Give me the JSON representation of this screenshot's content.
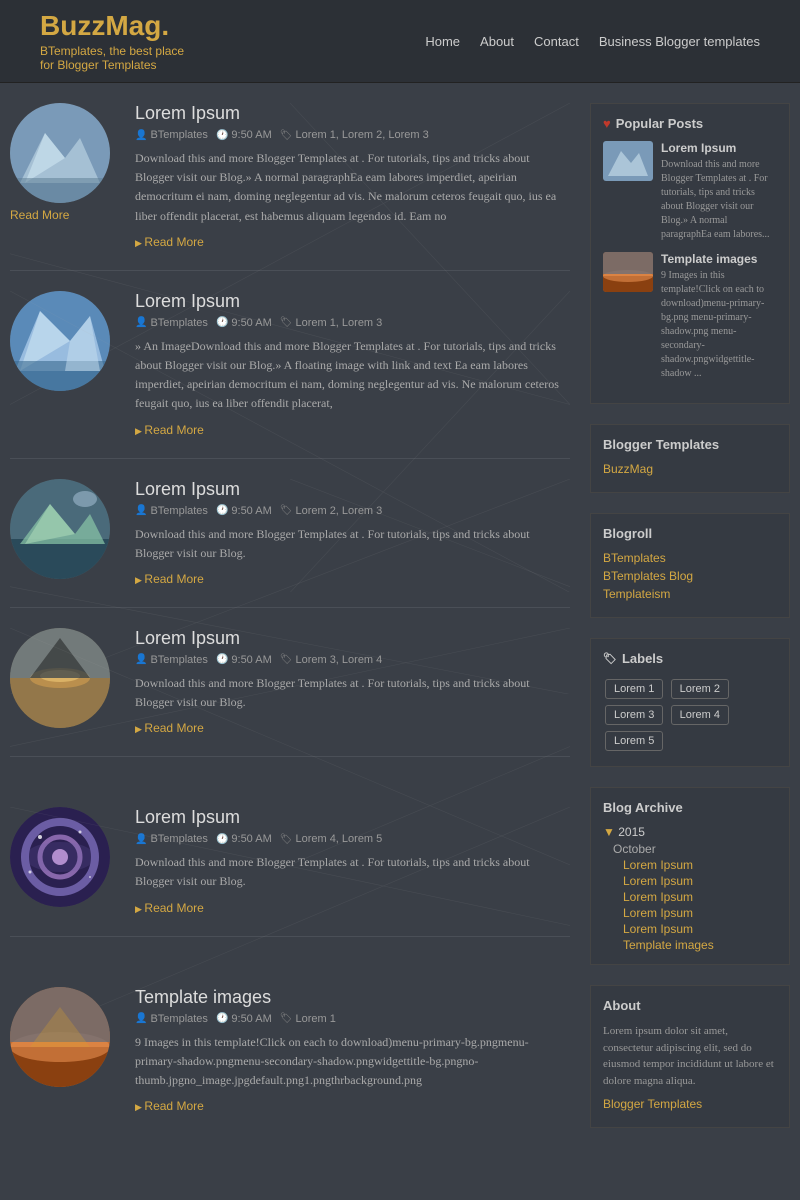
{
  "header": {
    "logo_main": "BuzzMag",
    "logo_dot": ".",
    "logo_sub_line1": "BTemplates, the best place",
    "logo_sub_line2": "for Blogger Templates",
    "nav": [
      {
        "label": "Home",
        "href": "#"
      },
      {
        "label": "About",
        "href": "#"
      },
      {
        "label": "Contact",
        "href": "#"
      },
      {
        "label": "Business Blogger templates",
        "href": "#"
      }
    ]
  },
  "posts": [
    {
      "id": "post1",
      "title": "Lorem Ipsum",
      "author": "BTemplates",
      "time": "9:50 AM",
      "tags": "Lorem 1, Lorem 2, Lorem 3",
      "excerpt": "Download this and more Blogger Templates at . For tutorials, tips and tricks about Blogger visit our Blog.» A normal paragraphEa eam labores imperdiet, apeirian democritum ei nam, doming neglegentur ad vis. Ne malorum ceteros feugait quo, ius ea liber offendit placerat, est habemus aliquam legendos id. Eam no",
      "read_more": "Read More",
      "img_type": "snow"
    },
    {
      "id": "post2",
      "title": "Lorem Ipsum",
      "author": "BTemplates",
      "time": "9:50 AM",
      "tags": "Lorem 1, Lorem 3",
      "excerpt": "» An ImageDownload this and more Blogger Templates at . For tutorials, tips and tricks about Blogger visit our Blog.» A floating image with link and text Ea eam labores imperdiet, apeirian democritum ei nam, doming neglegentur ad vis. Ne malorum ceteros feugait quo, ius ea liber offendit placerat,",
      "read_more": "Read More",
      "img_type": "blue_mountain"
    },
    {
      "id": "post3",
      "title": "Lorem Ipsum",
      "author": "BTemplates",
      "time": "9:50 AM",
      "tags": "Lorem 2, Lorem 3",
      "excerpt": "Download this and more Blogger Templates at . For tutorials, tips and tricks about Blogger visit our Blog.",
      "read_more": "Read More",
      "img_type": "green_mountain"
    },
    {
      "id": "post4",
      "title": "Lorem Ipsum",
      "author": "BTemplates",
      "time": "9:50 AM",
      "tags": "Lorem 3, Lorem 4",
      "excerpt": "Download this and more Blogger Templates at . For tutorials, tips and tricks about Blogger visit our Blog.",
      "read_more": "Read More",
      "img_type": "geothermal"
    },
    {
      "id": "post5",
      "title": "Lorem Ipsum",
      "author": "BTemplates",
      "time": "9:50 AM",
      "tags": "Lorem 4, Lorem 5",
      "excerpt": "Download this and more Blogger Templates at . For tutorials, tips and tricks about Blogger visit our Blog.",
      "read_more": "Read More",
      "img_type": "nebula"
    },
    {
      "id": "post6",
      "title": "Template images",
      "author": "BTemplates",
      "time": "9:50 AM",
      "tags": "Lorem 1",
      "excerpt": "9 Images in this template!Click on each to download)menu-primary-bg.pngmenu-primary-shadow.pngmenu-secondary-shadow.pngwidgettitle-bg.pngno-thumb.jpgno_image.jpgdefault.png1.pngthrbackground.png",
      "read_more": "Read More",
      "img_type": "sunset"
    }
  ],
  "sidebar": {
    "popular_posts_title": "Popular Posts",
    "popular_posts": [
      {
        "title": "Lorem Ipsum",
        "excerpt": "Download this and more Blogger Templates at . For tutorials, tips and tricks about Blogger visit our Blog.» A normal paragraphEa eam labores...",
        "img_type": "snow"
      },
      {
        "title": "Template images",
        "excerpt": "9 Images in this template!Click on each to download)menu-primary-bg.png menu-primary-shadow.png menu-secondary-shadow.pngwidgettitle-shadow ...",
        "img_type": "sunset"
      }
    ],
    "blogger_templates_title": "Blogger Templates",
    "blogger_templates_link": "BuzzMag",
    "blogroll_title": "Blogroll",
    "blogroll_links": [
      {
        "label": "BTemplates"
      },
      {
        "label": "BTemplates Blog"
      },
      {
        "label": "Templateism"
      }
    ],
    "labels_title": "Labels",
    "labels": [
      {
        "label": "Lorem 1"
      },
      {
        "label": "Lorem 2"
      },
      {
        "label": "Lorem 3"
      },
      {
        "label": "Lorem 4"
      },
      {
        "label": "Lorem 5"
      }
    ],
    "archive_title": "Blog Archive",
    "archive": [
      {
        "year": "2015",
        "months": [
          {
            "name": "October",
            "items": [
              "Lorem Ipsum",
              "Lorem Ipsum",
              "Lorem Ipsum",
              "Lorem Ipsum",
              "Lorem Ipsum",
              "Template images"
            ]
          }
        ]
      }
    ],
    "about_title": "About",
    "about_text": "Lorem ipsum dolor sit amet, consectetur adipiscing elit, sed do eiusmod tempor incididunt ut labore et dolore magna aliqua.",
    "about_link": "Blogger Templates"
  }
}
